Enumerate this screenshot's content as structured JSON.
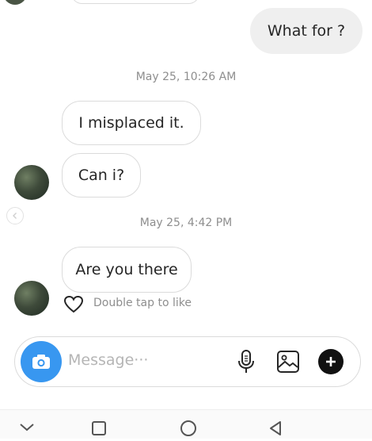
{
  "messages": {
    "outgoing_1": "What for ?",
    "stamp_1": "May 25, 10:26 AM",
    "incoming_1": "I misplaced it.",
    "incoming_2": "Can i?",
    "stamp_2": "May 25, 4:42 PM",
    "incoming_3": "Are you there",
    "like_hint": "Double tap to like"
  },
  "composer": {
    "placeholder": "Message···"
  },
  "icons": {
    "camera": "camera-icon",
    "mic": "microphone-icon",
    "gallery": "image-icon",
    "add": "plus-icon",
    "heart": "heart-icon",
    "back_arrow": "chevron-left-icon",
    "nav_down": "chevron-down-icon",
    "nav_square": "square-icon",
    "nav_home": "circle-icon",
    "nav_back": "triangle-back-icon"
  },
  "colors": {
    "accent": "#3897f0",
    "outgoing_bubble": "#efefef",
    "timestamp": "#8e8e8e"
  }
}
